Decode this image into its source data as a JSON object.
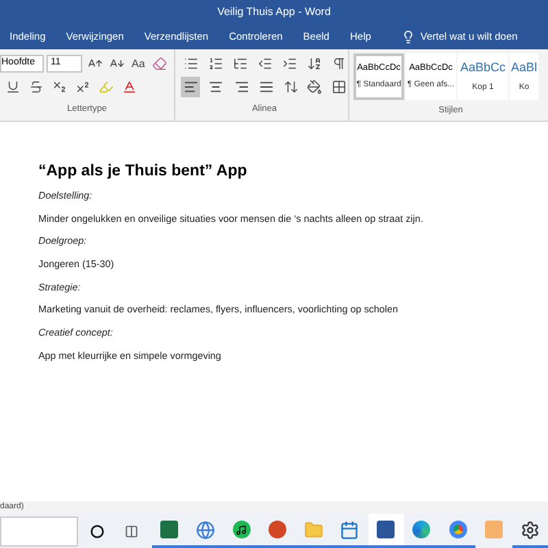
{
  "window": {
    "title": "Veilig Thuis App  -  Word"
  },
  "tabs": [
    {
      "label": "Indeling",
      "selected": false
    },
    {
      "label": "Verwijzingen",
      "selected": false
    },
    {
      "label": "Verzendlijsten",
      "selected": false
    },
    {
      "label": "Controleren",
      "selected": false
    },
    {
      "label": "Beeld",
      "selected": false
    },
    {
      "label": "Help",
      "selected": false
    }
  ],
  "tell_me": {
    "placeholder": "Vertel wat u wilt doen"
  },
  "ribbon": {
    "font": {
      "name": "Hoofdte",
      "size": "11",
      "change_case": "Aa"
    },
    "groups": [
      "Lettertype",
      "Alinea",
      "Stijlen"
    ],
    "alignment": [
      {
        "kind": "left",
        "selected": true
      },
      {
        "kind": "center",
        "selected": false
      },
      {
        "kind": "right",
        "selected": false
      },
      {
        "kind": "justify",
        "selected": false
      }
    ],
    "styles": [
      {
        "preview": "AaBbCcDc",
        "label": "¶ Standaard",
        "kind": "normal",
        "selected": true
      },
      {
        "preview": "AaBbCcDc",
        "label": "¶ Geen afs...",
        "kind": "normal",
        "selected": false
      },
      {
        "preview": "AaBbCc",
        "label": "Kop 1",
        "kind": "heading",
        "selected": false
      },
      {
        "preview": "AaBl",
        "label": "Ko",
        "kind": "heading",
        "selected": false
      }
    ]
  },
  "document": {
    "title": "“App als je Thuis bent” App",
    "paragraphs": [
      {
        "kind": "label",
        "text": "Doelstelling:"
      },
      {
        "kind": "body",
        "text": "Minder ongelukken en onveilige situaties voor mensen die ‘s nachts alleen op straat zijn."
      },
      {
        "kind": "label",
        "text": "Doelgroep:"
      },
      {
        "kind": "body",
        "text": "Jongeren (15-30)"
      },
      {
        "kind": "label",
        "text": "Strategie:"
      },
      {
        "kind": "body",
        "text": "Marketing vanuit de overheid: reclames, flyers, influencers, voorlichting op scholen"
      },
      {
        "kind": "label",
        "text": "Creatief concept:"
      },
      {
        "kind": "body",
        "text": "App met kleurrijke en simpele vormgeving"
      }
    ]
  },
  "status_bar": {
    "text": "daard)"
  },
  "taskbar": {
    "apps": [
      {
        "kind": "excel",
        "running": true,
        "selected": false
      },
      {
        "kind": "globe",
        "running": true,
        "selected": false
      },
      {
        "kind": "spotify",
        "running": true,
        "selected": false
      },
      {
        "kind": "powerpoint",
        "running": true,
        "selected": false
      },
      {
        "kind": "explorer",
        "running": true,
        "selected": false
      },
      {
        "kind": "calendar",
        "running": true,
        "selected": false
      },
      {
        "kind": "word",
        "running": true,
        "selected": true
      },
      {
        "kind": "edge",
        "running": true,
        "selected": false
      },
      {
        "kind": "chrome",
        "running": true,
        "selected": false
      },
      {
        "kind": "orange",
        "running": false,
        "selected": false
      },
      {
        "kind": "settings",
        "running": true,
        "selected": false
      }
    ]
  }
}
